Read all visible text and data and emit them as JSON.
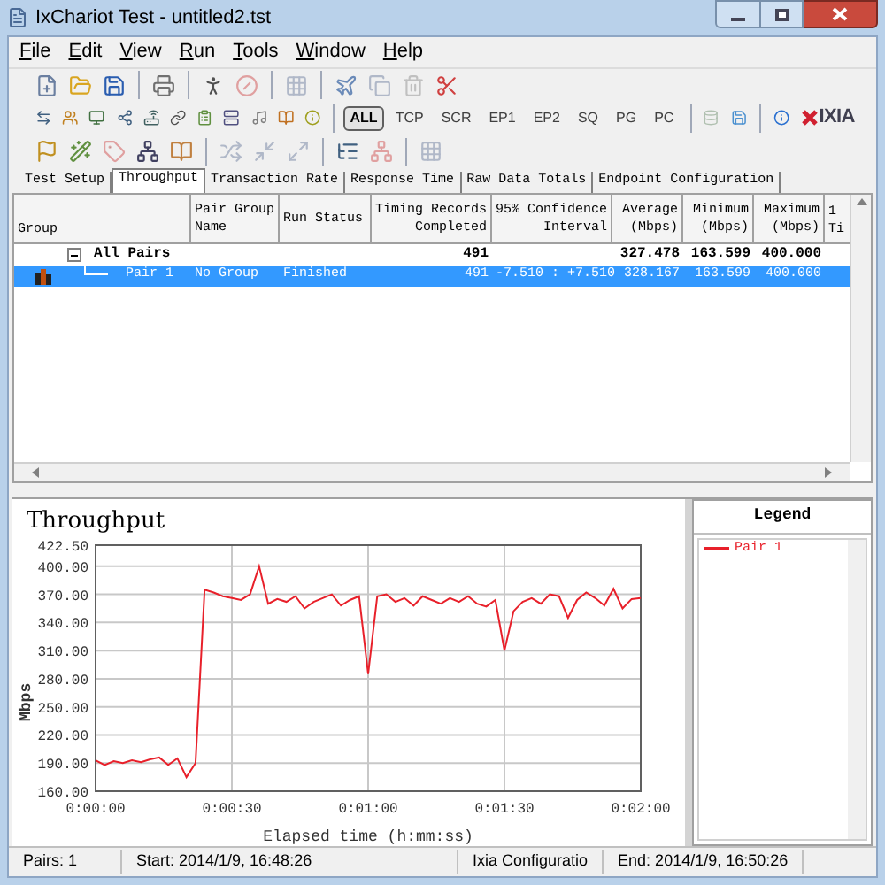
{
  "window": {
    "title": "IxChariot Test - untitled2.tst"
  },
  "menu": [
    "File",
    "Edit",
    "View",
    "Run",
    "Tools",
    "Window",
    "Help"
  ],
  "filters": [
    {
      "label": "ALL",
      "selected": true
    },
    {
      "label": "TCP",
      "selected": false
    },
    {
      "label": "SCR",
      "selected": false
    },
    {
      "label": "EP1",
      "selected": false
    },
    {
      "label": "EP2",
      "selected": false
    },
    {
      "label": "SQ",
      "selected": false
    },
    {
      "label": "PG",
      "selected": false
    },
    {
      "label": "PC",
      "selected": false
    }
  ],
  "logo": "IXIA",
  "tabs": [
    {
      "label": "Test Setup",
      "selected": false
    },
    {
      "label": "Throughput",
      "selected": true
    },
    {
      "label": "Transaction Rate",
      "selected": false
    },
    {
      "label": "Response Time",
      "selected": false
    },
    {
      "label": "Raw Data Totals",
      "selected": false
    },
    {
      "label": "Endpoint Configuration",
      "selected": false
    }
  ],
  "table": {
    "columns": [
      {
        "lines": [
          "Group"
        ]
      },
      {
        "lines": [
          "Pair Group",
          "Name"
        ]
      },
      {
        "lines": [
          "Run Status"
        ]
      },
      {
        "lines": [
          "Timing Records",
          "Completed"
        ]
      },
      {
        "lines": [
          "95% Confidence",
          "Interval"
        ]
      },
      {
        "lines": [
          "Average",
          "(Mbps)"
        ]
      },
      {
        "lines": [
          "Minimum",
          "(Mbps)"
        ]
      },
      {
        "lines": [
          "Maximum",
          "(Mbps)"
        ]
      },
      {
        "lines": [
          "1",
          "Ti"
        ]
      }
    ],
    "rows": [
      {
        "group": "All Pairs",
        "expanded": true,
        "selected": false,
        "timing_records": "491",
        "average": "327.478",
        "minimum": "163.599",
        "maximum": "400.000",
        "children": [
          {
            "group": "Pair 1",
            "selected": true,
            "pair_group_name": "No Group",
            "run_status": "Finished",
            "timing_records": "491",
            "confidence": "-7.510 : +7.510",
            "average": "328.167",
            "minimum": "163.599",
            "maximum": "400.000"
          }
        ]
      }
    ]
  },
  "chart": {
    "chart_data": {
      "type": "line",
      "grid": true,
      "title": "Throughput",
      "xlabel": "Elapsed time (h:mm:ss)",
      "ylabel": "Mbps",
      "x": [
        0,
        2,
        4,
        6,
        8,
        10,
        12,
        14,
        16,
        18,
        20,
        22,
        24,
        26,
        28,
        30,
        32,
        34,
        36,
        38,
        40,
        42,
        44,
        46,
        48,
        50,
        52,
        54,
        56,
        58,
        60,
        62,
        64,
        66,
        68,
        70,
        72,
        74,
        76,
        78,
        80,
        82,
        84,
        86,
        88,
        90,
        92,
        94,
        96,
        98,
        100,
        102,
        104,
        106,
        108,
        110,
        112,
        114,
        116,
        118,
        120
      ],
      "series": [
        {
          "name": "Pair 1",
          "color": "#e8202a",
          "values": [
            193,
            188,
            192,
            190,
            193,
            191,
            194,
            196,
            188,
            195,
            175,
            190,
            375,
            372,
            368,
            366,
            364,
            370,
            400,
            360,
            365,
            362,
            368,
            355,
            362,
            366,
            370,
            358,
            364,
            368,
            285,
            368,
            370,
            362,
            366,
            358,
            368,
            364,
            360,
            366,
            362,
            368,
            360,
            357,
            364,
            310,
            352,
            362,
            366,
            360,
            370,
            368,
            345,
            364,
            372,
            366,
            358,
            376,
            355,
            365,
            366
          ]
        }
      ],
      "xlim": [
        0,
        120
      ],
      "ylim": [
        160,
        422.5
      ],
      "xticks": [
        {
          "value": 0,
          "label": "0:00:00"
        },
        {
          "value": 30,
          "label": "0:00:30"
        },
        {
          "value": 60,
          "label": "0:01:00"
        },
        {
          "value": 90,
          "label": "0:01:30"
        },
        {
          "value": 120,
          "label": "0:02:00"
        }
      ],
      "yticks": [
        {
          "value": 160,
          "label": "160.00"
        },
        {
          "value": 190,
          "label": "190.00"
        },
        {
          "value": 220,
          "label": "220.00"
        },
        {
          "value": 250,
          "label": "250.00"
        },
        {
          "value": 280,
          "label": "280.00"
        },
        {
          "value": 310,
          "label": "310.00"
        },
        {
          "value": 340,
          "label": "340.00"
        },
        {
          "value": 370,
          "label": "370.00"
        },
        {
          "value": 400,
          "label": "400.00"
        },
        {
          "value": 422.5,
          "label": "422.50"
        }
      ]
    }
  },
  "legend": {
    "title": "Legend"
  },
  "status_bar": [
    "Pairs: 1",
    "Start: 2014/1/9, 16:48:26",
    "Ixia Configuratio",
    "End: 2014/1/9, 16:50:26"
  ]
}
